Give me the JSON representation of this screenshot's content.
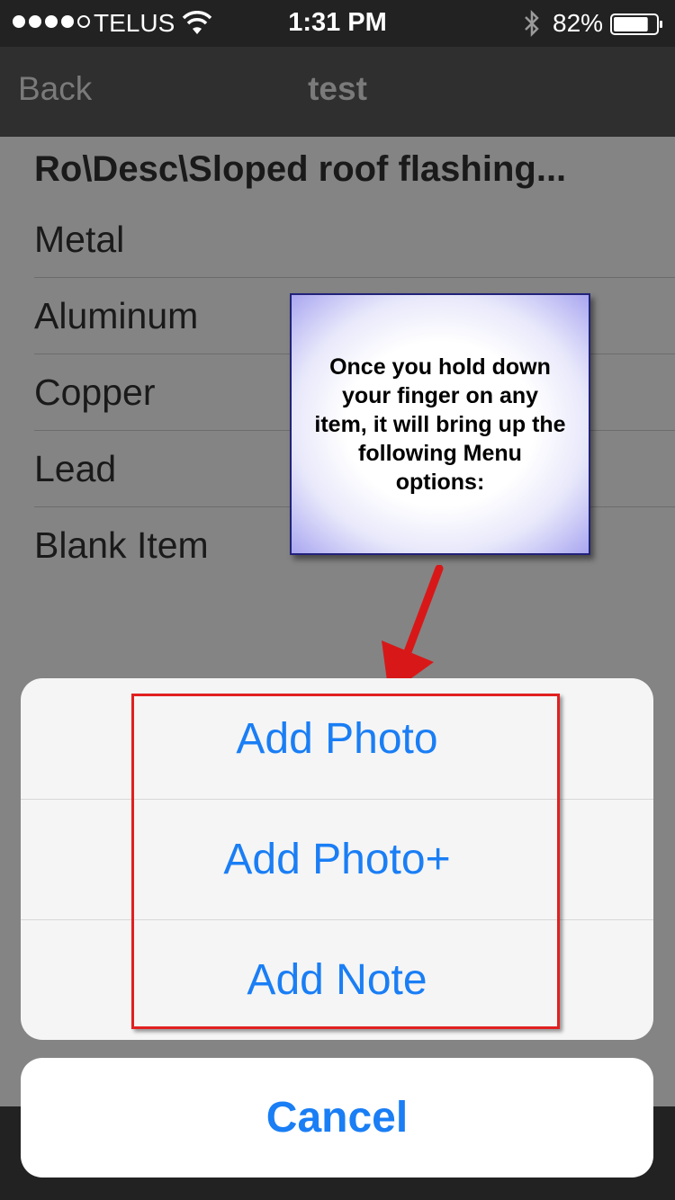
{
  "status_bar": {
    "carrier": "TELUS",
    "time": "1:31 PM",
    "battery_percent": "82%",
    "signal_bars": 4,
    "signal_total": 5,
    "battery_level": 0.82
  },
  "nav": {
    "back_label": "Back",
    "title": "test"
  },
  "content": {
    "path_header": "Ro\\Desc\\Sloped roof flashing...",
    "items": [
      {
        "label": "Metal"
      },
      {
        "label": "Aluminum"
      },
      {
        "label": "Copper"
      },
      {
        "label": "Lead"
      },
      {
        "label": "Blank Item"
      }
    ]
  },
  "callout": {
    "text": "Once you hold down your finger on any item, it will bring up the following Menu options:"
  },
  "action_sheet": {
    "options": [
      {
        "label": "Add Photo"
      },
      {
        "label": "Add Photo+"
      },
      {
        "label": "Add Note"
      }
    ],
    "cancel_label": "Cancel"
  },
  "colors": {
    "ios_blue": "#1a7ef5",
    "highlight_red": "#e12020",
    "callout_border": "#22227a"
  }
}
